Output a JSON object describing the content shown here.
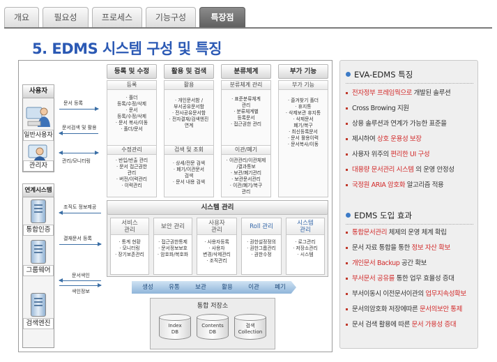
{
  "tabs": [
    {
      "label": "개요",
      "active": false
    },
    {
      "label": "필요성",
      "active": false
    },
    {
      "label": "프로세스",
      "active": false
    },
    {
      "label": "기능구성",
      "active": false
    },
    {
      "label": "특장점",
      "active": true
    }
  ],
  "page_title": "5. EDMS 시스템 구성 및 특징",
  "left": {
    "users_header": "사용자",
    "general_user": "일반사용자",
    "admin": "관리자",
    "linked_header": "연계시스템",
    "integrated_auth": "통합인증",
    "groupware": "그룹웨어",
    "search_engine": "검색엔진"
  },
  "arrows": {
    "doc_register": "문서 등록",
    "doc_search_use": "문서검색 및 활용",
    "admin_monitor": "관리/모니터링",
    "org_info": "조직도 정보제공",
    "approval_link": "결재문서 등록",
    "doc_index": "문서색인",
    "index_info": "색인정보"
  },
  "columns": [
    {
      "header": "등록 및 수정",
      "sub1": "등록",
      "items1": "· 폴더\n등록/수정/삭제\n· 문서\n등록/수정/삭제\n· 문서 복사/이동\n· 폴더/문서",
      "sub2": "수정관리",
      "items2": "· 반입/반출 관리\n· 문서 접근권한\n관리\n· 버전/이력관리\n· 이력관리"
    },
    {
      "header": "활용 및 검색",
      "sub1": "활용",
      "items1": "· 개인문서함 /\n부서공유문서함\n· 전사공유문서함\n· 전자결재/검색엔진\n연계",
      "sub2": "검색 및 조회",
      "items2": "· 상세/전문 검색\n· 폐기/이관문서\n검색\n· 문서 내용 검색"
    },
    {
      "header": "분류체계",
      "sub1": "분류체계 관리",
      "items1": "· 표준분류체계\n관리\n· 분류체계별\n등록문서\n· 접근권한 관리",
      "sub2": "이관/폐기",
      "items2": "· 이관관리/이관체제\n/결과통보\n· 보관/폐기관리\n· 보관문서관리\n· 이관/폐기/복구\n관리"
    },
    {
      "header": "부가 기능",
      "sub1": "부가 기능",
      "items1": "· 즐겨찾기 폴더\n· 휴지통\n· 삭제보관 휴지통\n· 삭제문서\n폐기/복구\n· 최신등록문서\n· 문서 활용이력\n· 문서복사/이동",
      "sub2": "",
      "items2": ""
    }
  ],
  "system_mgmt": {
    "title": "시스템 관리",
    "boxes": [
      {
        "title": "서비스\n관리",
        "items": "· 통계 현황\n· 모니터링\n· 장기보존관리"
      },
      {
        "title": "보안 관리",
        "items": "· 접근권한통제\n· 문서정보보호\n· 암호화/복호화"
      },
      {
        "title": "사용자\n관리",
        "items": "· 사용자등록\n· 사용자\n변경/삭제관리\n· 조직관리"
      },
      {
        "title": "Roll 관리",
        "items": "· 권한설정정의\n· 권한그룹관리\n· 권한수정"
      },
      {
        "title": "시스템\n관리",
        "items": "· 로그관리\n· 저장소관리\n· 시스템"
      }
    ]
  },
  "lifecycle": [
    "생성",
    "유통",
    "보관",
    "활용",
    "이관",
    "폐기"
  ],
  "storage": {
    "title": "통합 저장소",
    "dbs": [
      "Index\nDB",
      "Contents\nDB",
      "검색\nCollection"
    ]
  },
  "features": {
    "title": "EVA-EDMS 특징",
    "items": [
      {
        "pre": "",
        "hl": "전자정부 프레임웍으로",
        "post": " 개발된 솔루션"
      },
      {
        "pre": "Cross Browing 지원",
        "hl": "",
        "post": ""
      },
      {
        "pre": "상용 솔루션과 연계가 가능한 표준을",
        "hl": "",
        "post": ""
      },
      {
        "pre": "제시하여 ",
        "hl": "상호 운용성 보장",
        "post": ""
      },
      {
        "pre": "사용자 위주의 ",
        "hl": "편리한 UI 구성",
        "post": ""
      },
      {
        "pre": "",
        "hl": "대용량 문서관리 시스템",
        "post": " 의 운영 안정성"
      },
      {
        "pre": "",
        "hl": "국정원 ARIA 암호화",
        "post": " 알고리즘 적용"
      }
    ]
  },
  "effects": {
    "title": "EDMS 도입 효과",
    "items": [
      {
        "pre": "",
        "hl": "통합문서관리",
        "post": " 체제의  운영 체계 확립"
      },
      {
        "pre": "문서 자료 통합을 통한 ",
        "hl": "정보 자산 확보",
        "post": ""
      },
      {
        "pre": "",
        "hl": "개인문서 Backup",
        "post": " 공간 확보"
      },
      {
        "pre": "",
        "hl": "부서문서 공유를",
        "post": " 통한 업무 효율성 증대"
      },
      {
        "pre": "부서이동시 이전문서이관의 ",
        "hl": "업무지속성확보",
        "post": ""
      },
      {
        "pre": "문서의암호화 저장에따른 ",
        "hl": "문서의보안 통제",
        "post": ""
      },
      {
        "pre": "문서 검색 활용에 따른 ",
        "hl": "문서 가용성 증대",
        "post": ""
      }
    ]
  },
  "colors": {
    "accent": "#2b59b4",
    "highlight": "#d22a2a",
    "tab_active": "#6b6b6b"
  }
}
